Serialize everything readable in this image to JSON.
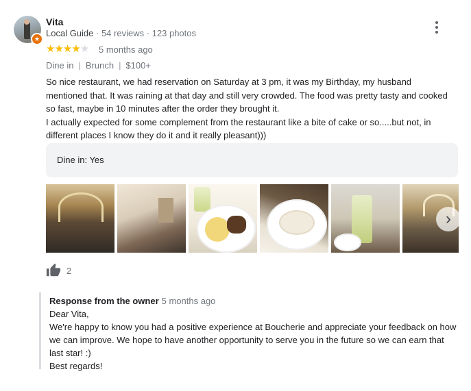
{
  "reviewer": {
    "name": "Vita",
    "badge": "Local Guide",
    "reviews": "54 reviews",
    "photos": "123 photos",
    "meta_separator": " · "
  },
  "rating": {
    "stars_filled": 4,
    "stars_total": 5,
    "time": "5 months ago",
    "star_color": "#fbbc04"
  },
  "tags": [
    "Dine in",
    "Brunch",
    "$100+"
  ],
  "review_text": [
    "So nice restaurant, we had reservation on Saturday at 3 pm, it was my Birthday,  my husband mentioned that. It was raining at that day and still very crowded. The food was pretty tasty and cooked so fast, maybe in 10 minutes after the  order they brought it.",
    "I actually expected for some complement from the restaurant like a bite of cake or so.....but not, in different places I know they do it and it really pleasant)))"
  ],
  "attributes": {
    "dine_in": "Dine in: Yes"
  },
  "photos": {
    "items": [
      "restaurant-interior-photo",
      "dining-room-photo",
      "potato-dish-photo",
      "pasta-dish-photo",
      "drinks-photo",
      "hall-interior-photo"
    ],
    "next_icon": "chevron-right-icon"
  },
  "likes": {
    "count": "2",
    "icon": "thumbs-up-icon"
  },
  "owner_response": {
    "title": "Response from the owner",
    "time": "5 months ago",
    "lines": [
      "Dear Vita,",
      "We're happy to know you had a positive experience at Boucherie and appreciate your feedback on how we can improve. We hope to have another opportunity to serve you in the future so we can earn that last star! :)",
      "Best regards!"
    ]
  },
  "colors": {
    "accent_badge": "#e8710a",
    "muted_text": "#70757a"
  }
}
